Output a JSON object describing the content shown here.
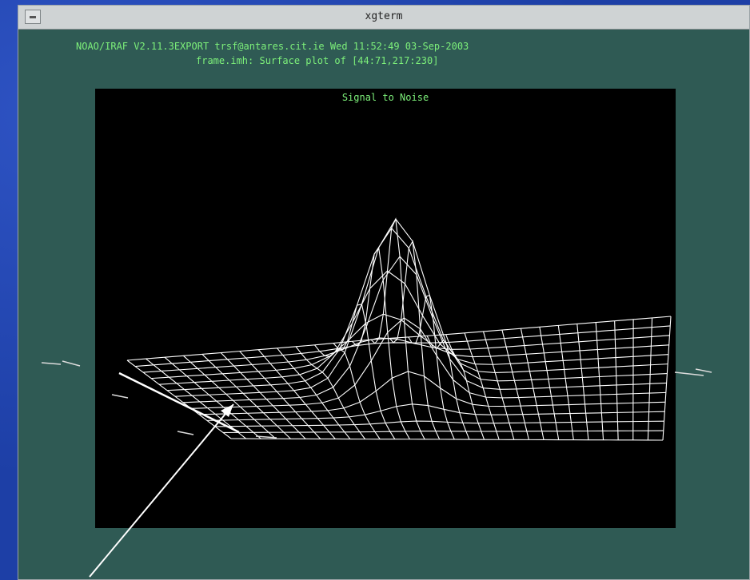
{
  "window": {
    "title": "xgterm",
    "menu_button_icon": "window-menu-icon"
  },
  "header": {
    "line1": "NOAO/IRAF V2.11.3EXPORT trsf@antares.cit.ie Wed 11:52:49 03-Sep-2003",
    "line2": "frame.imh: Surface plot of [44:71,217:230]"
  },
  "plot": {
    "title": "Signal to Noise",
    "type": "surface-wireframe",
    "colors": {
      "wire": "#ffffff",
      "text": "#7df07a",
      "background": "#000000"
    }
  },
  "annotation": {
    "arrow_icon": "pointer-arrow-icon"
  }
}
